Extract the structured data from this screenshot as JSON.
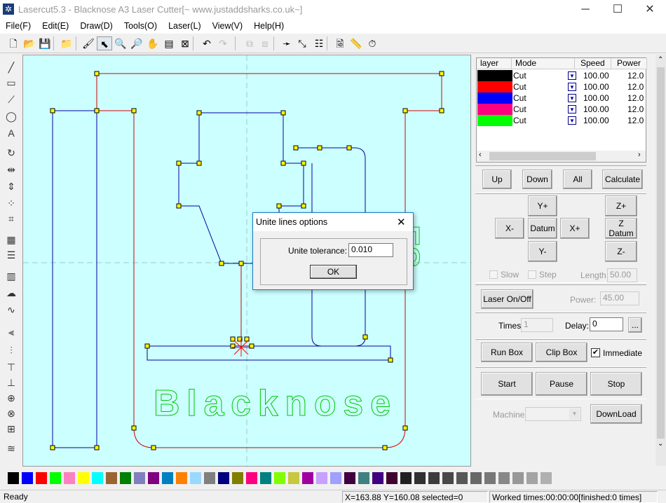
{
  "window": {
    "title": "Lasercut5.3 - Blacknose A3 Laser Cutter[~ www.justaddsharks.co.uk~]",
    "minimize": "─",
    "maximize": "☐",
    "close": "✕"
  },
  "menu": [
    "File(F)",
    "Edit(E)",
    "Draw(D)",
    "Tools(O)",
    "Laser(L)",
    "View(V)",
    "Help(H)"
  ],
  "toolbar": [
    {
      "icon": "new-file-icon",
      "g": "🗋"
    },
    {
      "icon": "open-folder-icon",
      "g": "📂"
    },
    {
      "icon": "save-icon",
      "g": "💾"
    },
    {
      "icon": "import-icon",
      "g": "📁"
    },
    {
      "icon": "paint-brush-icon",
      "g": "🖌"
    },
    {
      "icon": "select-pointer-icon",
      "g": "⬉"
    },
    {
      "icon": "zoom-in-icon",
      "g": "🔍"
    },
    {
      "icon": "zoom-out-icon",
      "g": "🔎"
    },
    {
      "icon": "pan-hand-icon",
      "g": "✋"
    },
    {
      "icon": "zoom-page-icon",
      "g": "▤"
    },
    {
      "icon": "zoom-fit-icon",
      "g": "⊠"
    },
    {
      "icon": "undo-icon",
      "g": "↶"
    },
    {
      "icon": "redo-icon",
      "g": "↷"
    },
    {
      "icon": "group-icon",
      "g": "⧉"
    },
    {
      "icon": "ungroup-icon",
      "g": "⧈"
    },
    {
      "icon": "direction-icon",
      "g": "➛"
    },
    {
      "icon": "start-point-icon",
      "g": "⤡"
    },
    {
      "icon": "layer-list-icon",
      "g": "☷"
    },
    {
      "icon": "preview-icon",
      "g": "🗟"
    },
    {
      "icon": "ruler-icon",
      "g": "📏"
    },
    {
      "icon": "timer-icon",
      "g": "⏱"
    }
  ],
  "left_tools": [
    {
      "icon": "line-tool-icon",
      "g": "╱"
    },
    {
      "icon": "rectangle-tool-icon",
      "g": "▭"
    },
    {
      "icon": "polyline-tool-icon",
      "g": "⟋"
    },
    {
      "icon": "ellipse-tool-icon",
      "g": "◯"
    },
    {
      "icon": "text-tool-icon",
      "g": "A"
    },
    {
      "icon": "rotate-icon",
      "g": "↻"
    },
    {
      "icon": "mirror-h-icon",
      "g": "⇹"
    },
    {
      "icon": "mirror-v-icon",
      "g": "⇕"
    },
    {
      "icon": "node-edit-icon",
      "g": "⁘"
    },
    {
      "icon": "crop-icon",
      "g": "⌗"
    },
    {
      "icon": "array-icon",
      "g": "▦"
    },
    {
      "icon": "align-icon",
      "g": "☰"
    },
    {
      "icon": "hatch-icon",
      "g": "▥"
    },
    {
      "icon": "cloud-icon",
      "g": "☁"
    },
    {
      "icon": "curve-icon",
      "g": "∿"
    },
    {
      "icon": "align-left-icon",
      "g": "⫷"
    },
    {
      "icon": "align-center-icon",
      "g": "⫶"
    },
    {
      "icon": "align-top-icon",
      "g": "⊤"
    },
    {
      "icon": "align-bottom-icon",
      "g": "⊥"
    },
    {
      "icon": "center-h-icon",
      "g": "⊕"
    },
    {
      "icon": "center-v-icon",
      "g": "⊗"
    },
    {
      "icon": "center-both-icon",
      "g": "⊞"
    },
    {
      "icon": "layers-icon",
      "g": "≋"
    }
  ],
  "canvas": {
    "text_blacknose": "Blacknose",
    "text_vertical": "ES"
  },
  "layers": {
    "headers": [
      "layer",
      "Mode",
      "Speed",
      "Power"
    ],
    "rows": [
      {
        "color": "#000000",
        "mode": "Cut",
        "speed": "100.00",
        "power": "12.0"
      },
      {
        "color": "#ff0000",
        "mode": "Cut",
        "speed": "100.00",
        "power": "12.0"
      },
      {
        "color": "#0000ff",
        "mode": "Cut",
        "speed": "100.00",
        "power": "12.0"
      },
      {
        "color": "#ff0080",
        "mode": "Cut",
        "speed": "100.00",
        "power": "12.0"
      },
      {
        "color": "#00ff00",
        "mode": "Cut",
        "speed": "100.00",
        "power": "12.0"
      }
    ]
  },
  "panel": {
    "up": "Up",
    "down": "Down",
    "all": "All",
    "calculate": "Calculate",
    "yplus": "Y+",
    "xminus": "X-",
    "datum": "Datum",
    "xplus": "X+",
    "yminus": "Y-",
    "zplus": "Z+",
    "zdatum": "Z Datum",
    "zminus": "Z-",
    "slow": "Slow",
    "step": "Step",
    "length_label": "Length:",
    "length": "50.00",
    "laser_onoff": "Laser On/Off",
    "power_label": "Power:",
    "power": "45.00",
    "times_label": "Times:",
    "times": "1",
    "delay_label": "Delay:",
    "delay": "0",
    "more": "...",
    "run_box": "Run Box",
    "clip_box": "Clip Box",
    "immediate": "Immediate",
    "immediate_checked": true,
    "start": "Start",
    "pause": "Pause",
    "stop": "Stop",
    "machine_label": "Machine:",
    "machine": "",
    "download": "DownLoad"
  },
  "palette": [
    "#000000",
    "#0000ff",
    "#ff0000",
    "#00ff00",
    "#ff80c0",
    "#ffff00",
    "#00ffff",
    "#996633",
    "#008000",
    "#8080c0",
    "#800080",
    "#0080c0",
    "#ff8000",
    "#99d9ff",
    "#808080",
    "#000080",
    "#808000",
    "#ff0080",
    "#008080",
    "#80ff00",
    "#c8c840",
    "#a000a0",
    "#c8a0ff",
    "#a0a0ff",
    "#400040",
    "#408080",
    "#400080",
    "#400030",
    "#202020",
    "#303030",
    "#3c3c3c",
    "#484848",
    "#585858",
    "#686868",
    "#787878",
    "#888888",
    "#989898",
    "#a4a4a4",
    "#b0b0b0"
  ],
  "dialog": {
    "title": "Unite lines options",
    "close": "✕",
    "tolerance_label": "Unite tolerance:",
    "tolerance": "0.010",
    "ok": "OK"
  },
  "status": {
    "ready": "Ready",
    "coords": "X=163.88 Y=160.08 selected=0",
    "worked": "Worked times:00:00:00[finished:0 times]"
  }
}
